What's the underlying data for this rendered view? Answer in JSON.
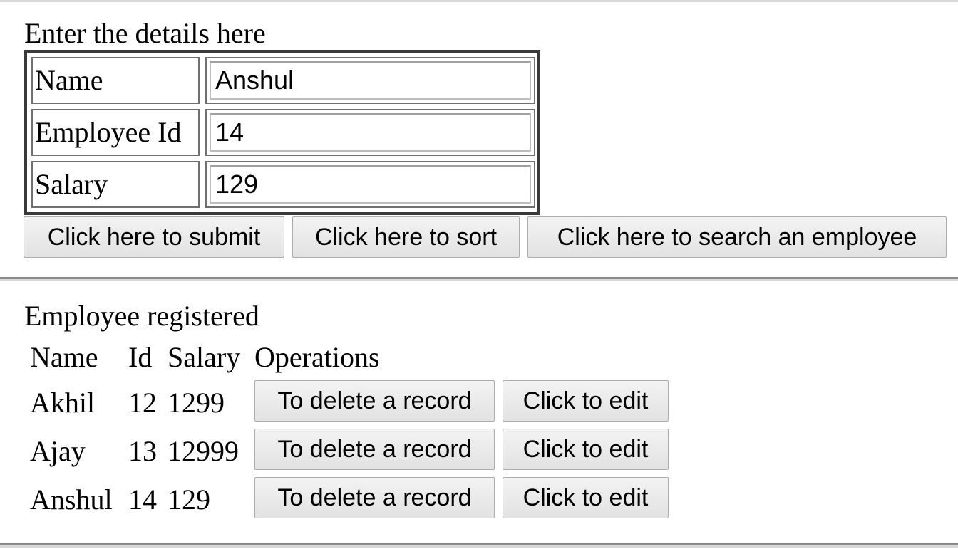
{
  "form": {
    "heading": "Enter the details here",
    "fields": [
      {
        "label": "Name",
        "value": "Anshul"
      },
      {
        "label": "Employee Id",
        "value": "14"
      },
      {
        "label": "Salary",
        "value": "129"
      }
    ],
    "buttons": {
      "submit": "Click here to submit",
      "sort": "Click here to sort",
      "search": "Click here to search an employee"
    }
  },
  "list": {
    "heading": "Employee registered",
    "columns": [
      "Name",
      "Id",
      "Salary",
      "Operations"
    ],
    "rows": [
      {
        "name": "Akhil",
        "id": "12",
        "salary": "1299",
        "delete_label": "To delete a record",
        "edit_label": "Click to edit"
      },
      {
        "name": "Ajay",
        "id": "13",
        "salary": "12999",
        "delete_label": "To delete a record",
        "edit_label": "Click to edit"
      },
      {
        "name": "Anshul",
        "id": "14",
        "salary": "129",
        "delete_label": "To delete a record",
        "edit_label": "Click to edit"
      }
    ]
  }
}
